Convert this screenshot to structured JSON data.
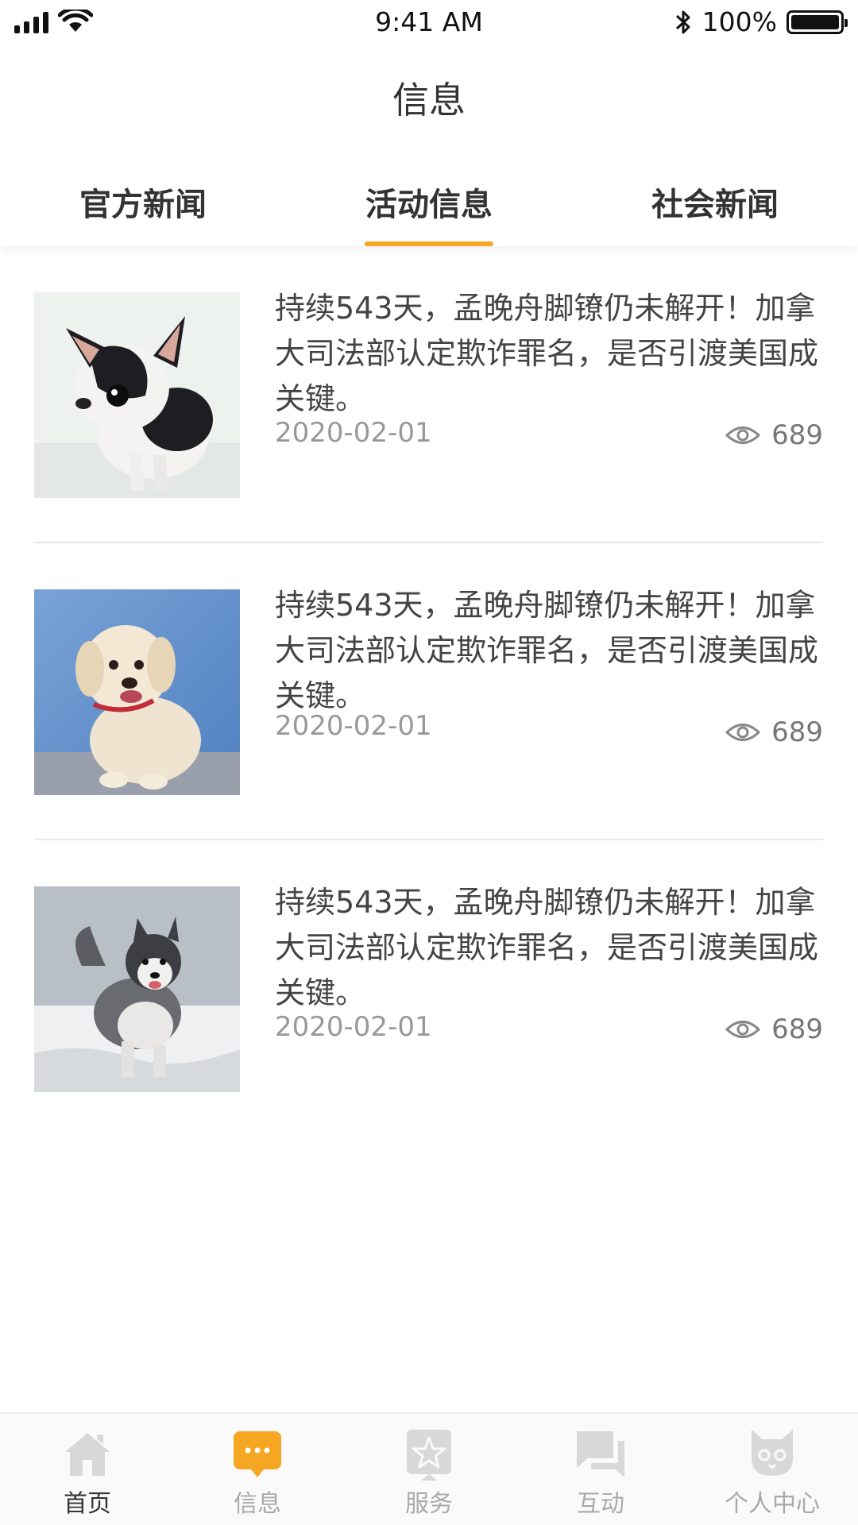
{
  "status_bar": {
    "time": "9:41 AM",
    "battery": "100%"
  },
  "nav": {
    "title": "信息"
  },
  "tabs": [
    {
      "label": "官方新闻",
      "active": false
    },
    {
      "label": "活动信息",
      "active": true
    },
    {
      "label": "社会新闻",
      "active": false
    }
  ],
  "articles": [
    {
      "title": "持续543天，孟晚舟脚镣仍未解开！加拿大司法部认定欺诈罪名，是否引渡美国成关键。",
      "date": "2020-02-01",
      "views": "689",
      "image": "chihuahua-puppy"
    },
    {
      "title": "持续543天，孟晚舟脚镣仍未解开！加拿大司法部认定欺诈罪名，是否引渡美国成关键。",
      "date": "2020-02-01",
      "views": "689",
      "image": "labrador-puppy"
    },
    {
      "title": "持续543天，孟晚舟脚镣仍未解开！加拿大司法部认定欺诈罪名，是否引渡美国成关键。",
      "date": "2020-02-01",
      "views": "689",
      "image": "husky-in-snow"
    }
  ],
  "tabbar": [
    {
      "label": "首页",
      "icon": "home-icon"
    },
    {
      "label": "信息",
      "icon": "message-icon",
      "active": true
    },
    {
      "label": "服务",
      "icon": "star-icon"
    },
    {
      "label": "互动",
      "icon": "chat-icon"
    },
    {
      "label": "个人中心",
      "icon": "cat-profile-icon"
    }
  ],
  "colors": {
    "accent": "#f5a623",
    "inactive_icon": "#d8d8d8"
  }
}
